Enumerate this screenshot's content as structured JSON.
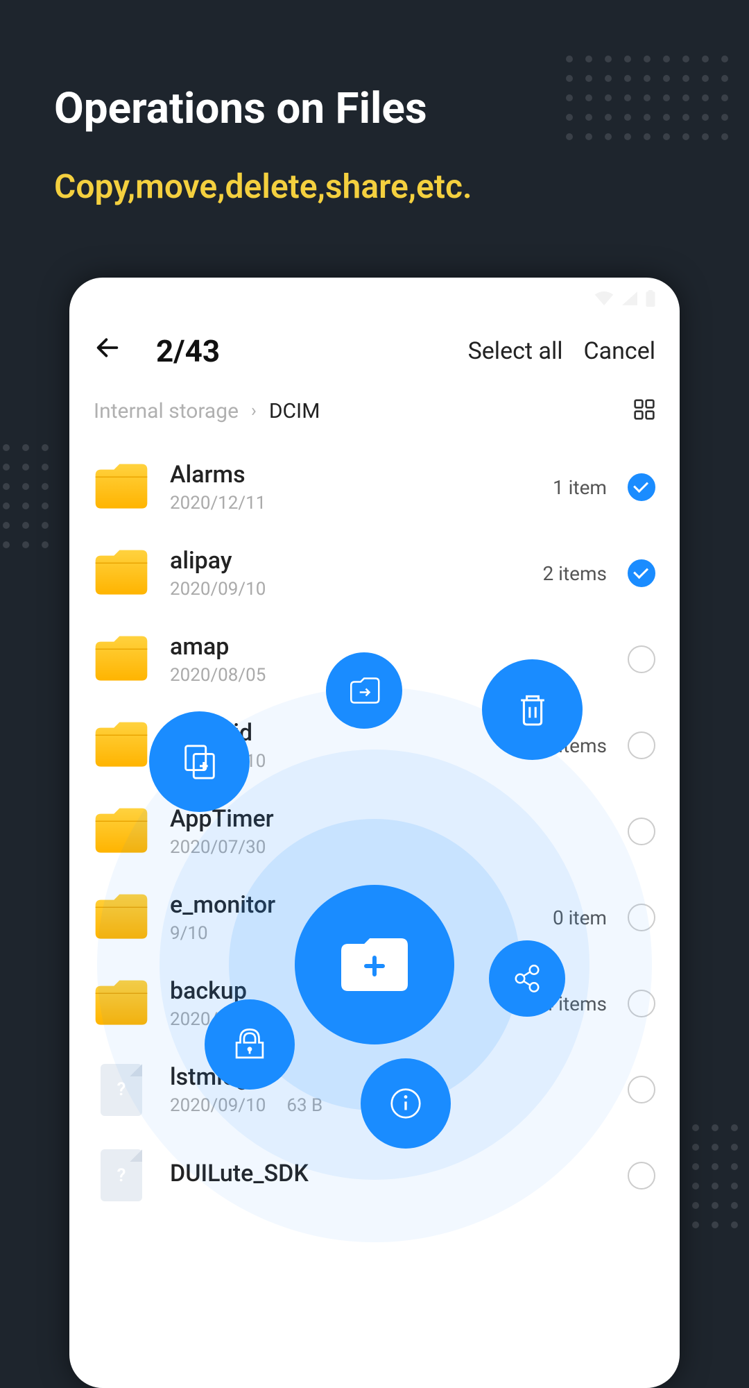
{
  "promo": {
    "title": "Operations on Files",
    "subtitle": "Copy,move,delete,share,etc."
  },
  "header": {
    "counter": "2/43",
    "select_all": "Select all",
    "cancel": "Cancel"
  },
  "breadcrumbs": {
    "root": "Internal storage",
    "current": "DCIM"
  },
  "files": [
    {
      "name": "Alarms",
      "date": "2020/12/11",
      "count": "1 item",
      "selected": true,
      "type": "folder"
    },
    {
      "name": "alipay",
      "date": "2020/09/10",
      "count": "2 items",
      "selected": true,
      "type": "folder"
    },
    {
      "name": "amap",
      "date": "2020/08/05",
      "count": "",
      "selected": false,
      "type": "folder"
    },
    {
      "name": "Android",
      "date": "2020/09/10",
      "count": "5 items",
      "selected": false,
      "type": "folder"
    },
    {
      "name": "AppTimer",
      "date": "2020/07/30",
      "count": "",
      "selected": false,
      "type": "folder"
    },
    {
      "name": "e_monitor",
      "date": "9/10",
      "count": "0 item",
      "selected": false,
      "type": "folder"
    },
    {
      "name": "backup",
      "date": "2020/11/25",
      "count": "4 items",
      "selected": false,
      "type": "folder"
    },
    {
      "name": "lstmlog",
      "date": "2020/09/10",
      "size": "63 B",
      "count": "",
      "selected": false,
      "type": "file"
    },
    {
      "name": "DUILute_SDK",
      "date": "",
      "count": "",
      "selected": false,
      "type": "file"
    }
  ],
  "fab": {
    "center": "new-folder",
    "actions": [
      "copy",
      "move",
      "delete",
      "share",
      "lock",
      "info"
    ]
  }
}
